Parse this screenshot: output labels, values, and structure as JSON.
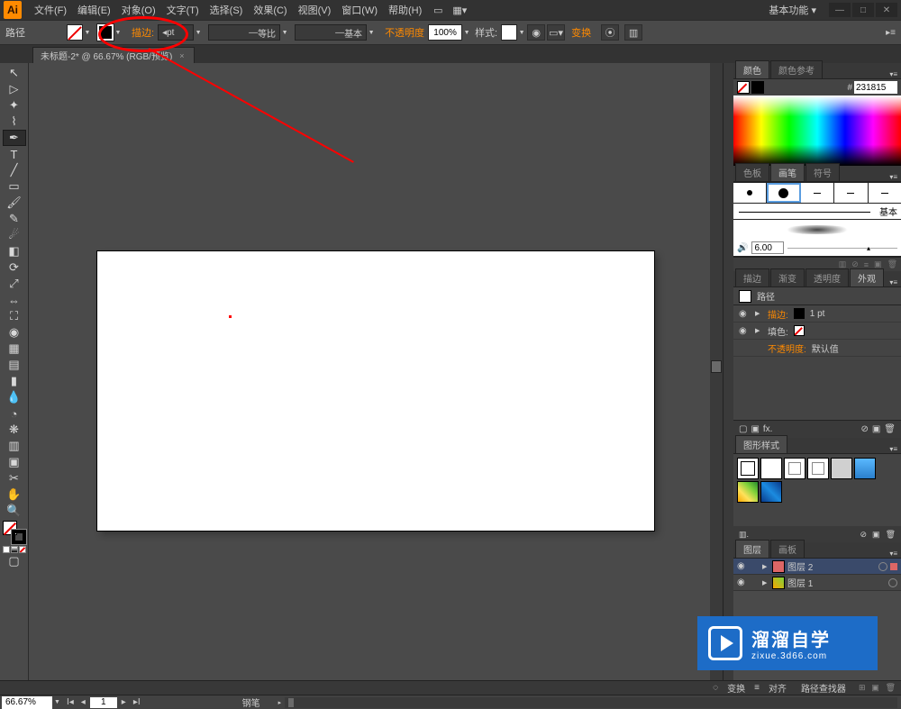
{
  "app": {
    "logo": "Ai",
    "workspace": "基本功能"
  },
  "menu": {
    "file": "文件(F)",
    "edit": "编辑(E)",
    "object": "对象(O)",
    "type": "文字(T)",
    "select": "选择(S)",
    "effect": "效果(C)",
    "view": "视图(V)",
    "window": "窗口(W)",
    "help": "帮助(H)"
  },
  "controlbar": {
    "path_label": "路径",
    "stroke_label": "描边:",
    "stroke_weight": "pt",
    "profile_uniform": "等比",
    "profile_basic": "基本",
    "opacity_label": "不透明度",
    "opacity_value": "100%",
    "style_label": "样式:",
    "transform": "变换"
  },
  "doctab": {
    "title": "未标题-2* @ 66.67% (RGB/预览)"
  },
  "color_panel": {
    "tab_color": "颜色",
    "tab_guide": "颜色参考",
    "hex_prefix": "#",
    "hex_value": "231815"
  },
  "brush_panel": {
    "tab_swatches": "色板",
    "tab_brushes": "画笔",
    "tab_symbols": "符号",
    "basic": "基本",
    "size": "6.00"
  },
  "appearance": {
    "tab_stroke": "描边",
    "tab_gradient": "渐变",
    "tab_opacity": "透明度",
    "tab_appear": "外观",
    "header": "路径",
    "stroke_label": "描边:",
    "stroke_weight": "1 pt",
    "fill_label": "填色:",
    "opacity_label": "不透明度:",
    "opacity_value": "默认值",
    "fx": "fx."
  },
  "gstyles": {
    "tab": "图形样式"
  },
  "layers": {
    "tab_layers": "图层",
    "tab_artboards": "画板",
    "layer2": "图层 2",
    "layer1": "图层 1"
  },
  "bottom_tabs": {
    "transform": "变换",
    "align": "对齐",
    "pathfinder": "路径查找器"
  },
  "statusbar": {
    "zoom": "66.67%",
    "page": "1",
    "tool": "钢笔"
  },
  "watermark": {
    "brand": "溜溜自学",
    "url": "zixue.3d66.com"
  }
}
